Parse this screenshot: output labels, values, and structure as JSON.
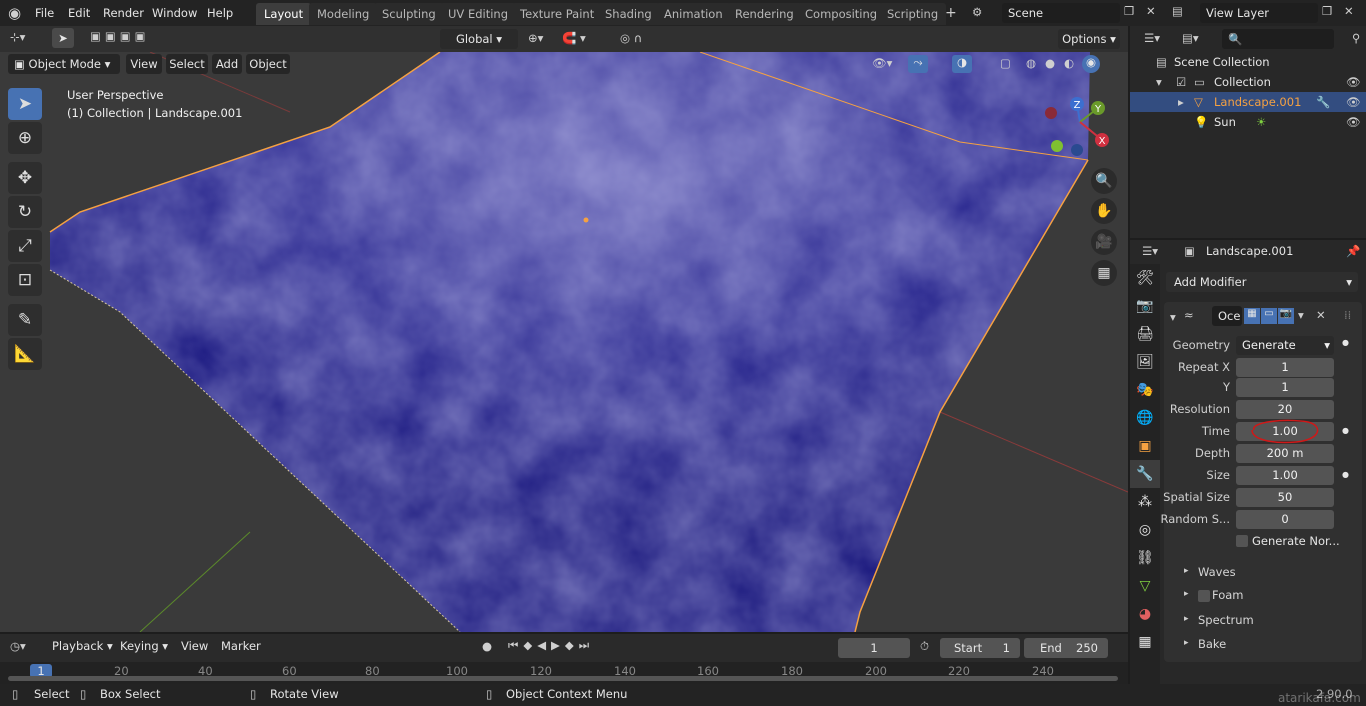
{
  "menu": {
    "file": "File",
    "edit": "Edit",
    "render": "Render",
    "window": "Window",
    "help": "Help"
  },
  "workspaces": [
    "Layout",
    "Modeling",
    "Sculpting",
    "UV Editing",
    "Texture Paint",
    "Shading",
    "Animation",
    "Rendering",
    "Compositing",
    "Scripting"
  ],
  "scene": "Scene",
  "view_layer": "View Layer",
  "viewport_header": {
    "transform": "Global",
    "options": "Options",
    "mode": "Object Mode",
    "view": "View",
    "select": "Select",
    "add": "Add",
    "object": "Object"
  },
  "viewport": {
    "perspective": "User Perspective",
    "collection_info": "(1) Collection | Landscape.001",
    "gizmo_x": "X",
    "gizmo_y": "Y",
    "gizmo_z": "Z"
  },
  "outliner": {
    "scene_collection": "Scene Collection",
    "collection": "Collection",
    "landscape": "Landscape.001",
    "sun": "Sun"
  },
  "properties": {
    "object_name": "Landscape.001",
    "add_modifier": "Add Modifier",
    "modifier_name": "Oce",
    "rows": [
      {
        "label": "Geometry",
        "value": "Generate"
      },
      {
        "label": "Repeat X",
        "value": "1"
      },
      {
        "label": "Y",
        "value": "1"
      },
      {
        "label": "Resolution",
        "value": "20"
      },
      {
        "label": "Time",
        "value": "1.00"
      },
      {
        "label": "Depth",
        "value": "200 m"
      },
      {
        "label": "Size",
        "value": "1.00"
      },
      {
        "label": "Spatial Size",
        "value": "50"
      },
      {
        "label": "Random S...",
        "value": "0"
      }
    ],
    "generate_normals": "Generate Nor...",
    "subpanels": [
      "Waves",
      "Foam",
      "Spectrum",
      "Bake"
    ]
  },
  "timeline": {
    "playback": "Playback",
    "keying": "Keying",
    "view": "View",
    "marker": "Marker",
    "current_frame": "1",
    "start_label": "Start",
    "start": "1",
    "end_label": "End",
    "end": "250",
    "ticks": [
      "1",
      "20",
      "40",
      "60",
      "80",
      "100",
      "120",
      "140",
      "160",
      "180",
      "200",
      "220",
      "240"
    ]
  },
  "status": {
    "select": "Select",
    "box_select": "Box Select",
    "rotate_view": "Rotate View",
    "context_menu": "Object Context Menu",
    "version": "2.90.0",
    "watermark": "atarikafa.com"
  },
  "colors": {
    "accent": "#4772b3",
    "ocean": "#1f1d7a",
    "selection": "#f5a142",
    "annotation": "#d01818"
  }
}
